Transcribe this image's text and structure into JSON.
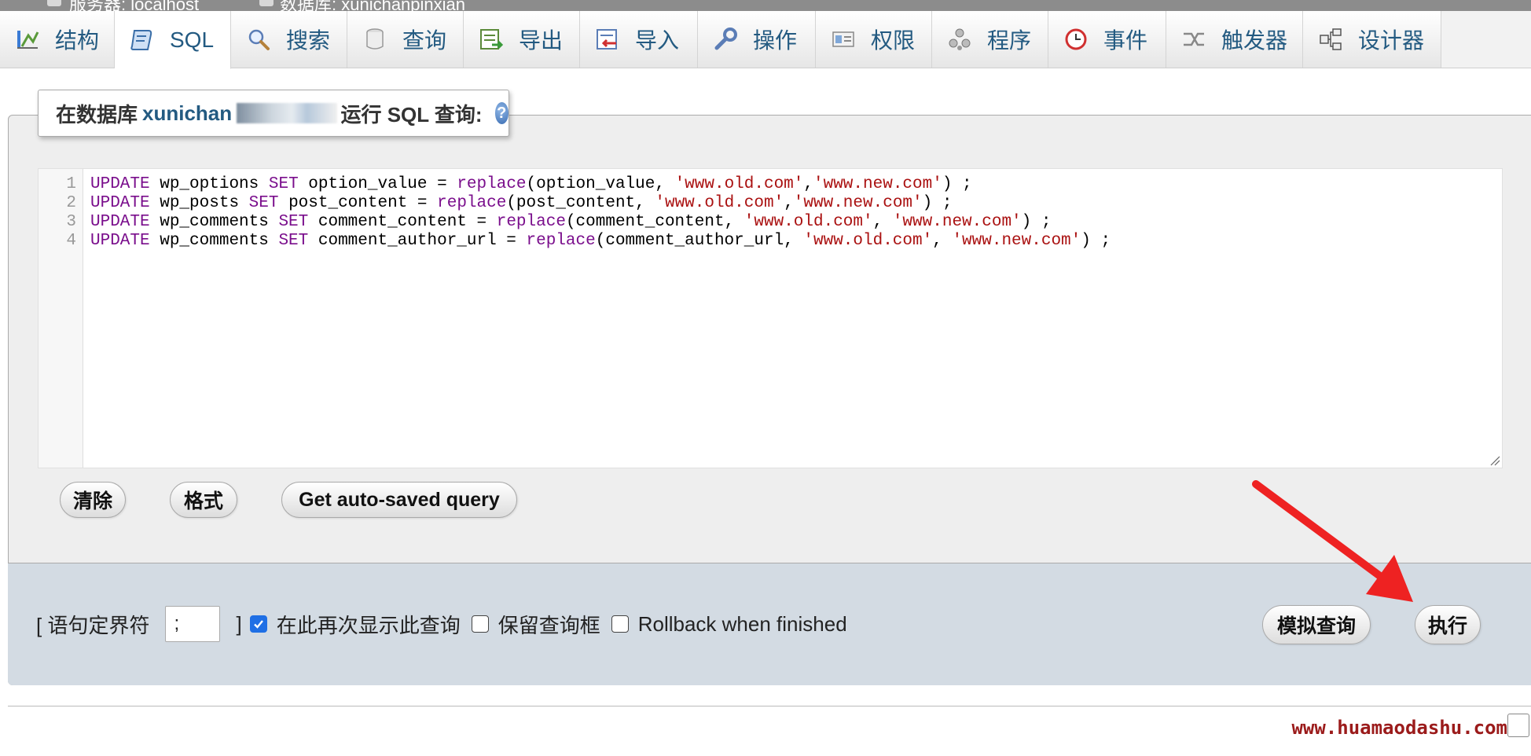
{
  "breadcrumb": [
    {
      "label": "服务器: localhost"
    },
    {
      "label": "数据库: xunichanpinxian"
    }
  ],
  "tabs": [
    {
      "label": "结构",
      "icon": "structure-icon"
    },
    {
      "label": "SQL",
      "icon": "sql-scroll-icon",
      "active": true
    },
    {
      "label": "搜索",
      "icon": "search-icon"
    },
    {
      "label": "查询",
      "icon": "query-icon"
    },
    {
      "label": "导出",
      "icon": "export-icon"
    },
    {
      "label": "导入",
      "icon": "import-icon"
    },
    {
      "label": "操作",
      "icon": "wrench-icon"
    },
    {
      "label": "权限",
      "icon": "privileges-icon"
    },
    {
      "label": "程序",
      "icon": "routines-icon"
    },
    {
      "label": "事件",
      "icon": "clock-icon"
    },
    {
      "label": "触发器",
      "icon": "triggers-icon"
    },
    {
      "label": "设计器",
      "icon": "designer-icon"
    }
  ],
  "legend": {
    "prefix": "在数据库",
    "dbname": "xunichan",
    "suffix": "运行 SQL 查询:"
  },
  "editor": {
    "lines": [
      {
        "n": "1",
        "tokens": [
          [
            "kw",
            "UPDATE"
          ],
          [
            "p",
            " wp_options "
          ],
          [
            "kw",
            "SET"
          ],
          [
            "p",
            " option_value = "
          ],
          [
            "kw",
            "replace"
          ],
          [
            "p",
            "(option_value, "
          ],
          [
            "s",
            "'www.old.com'"
          ],
          [
            "p",
            ","
          ],
          [
            "s",
            "'www.new.com'"
          ],
          [
            "p",
            ") ;"
          ]
        ]
      },
      {
        "n": "2",
        "tokens": [
          [
            "kw",
            "UPDATE"
          ],
          [
            "p",
            " wp_posts "
          ],
          [
            "kw",
            "SET"
          ],
          [
            "p",
            " post_content = "
          ],
          [
            "kw",
            "replace"
          ],
          [
            "p",
            "(post_content, "
          ],
          [
            "s",
            "'www.old.com'"
          ],
          [
            "p",
            ","
          ],
          [
            "s",
            "'www.new.com'"
          ],
          [
            "p",
            ") ;"
          ]
        ]
      },
      {
        "n": "3",
        "tokens": [
          [
            "kw",
            "UPDATE"
          ],
          [
            "p",
            " wp_comments "
          ],
          [
            "kw",
            "SET"
          ],
          [
            "p",
            " comment_content = "
          ],
          [
            "kw",
            "replace"
          ],
          [
            "p",
            "(comment_content, "
          ],
          [
            "s",
            "'www.old.com'"
          ],
          [
            "p",
            ", "
          ],
          [
            "s",
            "'www.new.com'"
          ],
          [
            "p",
            ") ;"
          ]
        ]
      },
      {
        "n": "4",
        "tokens": [
          [
            "kw",
            "UPDATE"
          ],
          [
            "p",
            " wp_comments "
          ],
          [
            "kw",
            "SET"
          ],
          [
            "p",
            " comment_author_url = "
          ],
          [
            "kw",
            "replace"
          ],
          [
            "p",
            "(comment_author_url, "
          ],
          [
            "s",
            "'www.old.com'"
          ],
          [
            "p",
            ", "
          ],
          [
            "s",
            "'www.new.com'"
          ],
          [
            "p",
            ") ;"
          ]
        ]
      }
    ]
  },
  "buttons": {
    "clear": "清除",
    "format": "格式",
    "autosaved": "Get auto-saved query",
    "simulate": "模拟查询",
    "go": "执行"
  },
  "options": {
    "delimiter_label_open": "[ 语句定界符",
    "delimiter_value": ";",
    "delimiter_label_close": "]",
    "show_again_label": "在此再次显示此查询",
    "show_again_checked": true,
    "retain_box_label": "保留查询框",
    "retain_box_checked": false,
    "rollback_label": "Rollback when finished",
    "rollback_checked": false
  },
  "watermark": "www.huamaodashu.com",
  "colors": {
    "tab_text": "#235a81",
    "keyword": "#7a0e8c",
    "string": "#aa1111",
    "options_bg": "#d3dbe3",
    "annotation_arrow": "#ee2222",
    "watermark": "#9b1b1b"
  }
}
